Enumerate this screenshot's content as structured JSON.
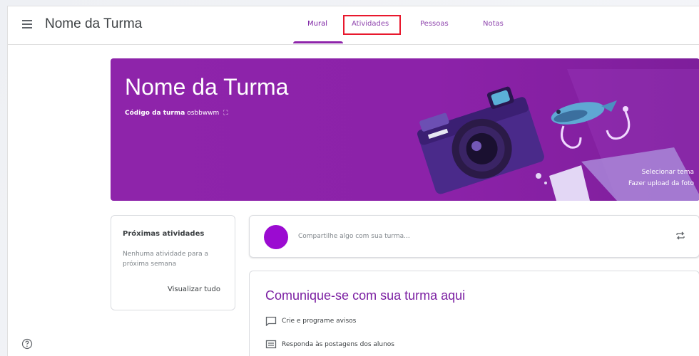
{
  "header": {
    "class_name": "Nome da Turma",
    "tabs": [
      {
        "label": "Mural",
        "active": true
      },
      {
        "label": "Atividades",
        "highlighted": true
      },
      {
        "label": "Pessoas"
      },
      {
        "label": "Notas"
      }
    ],
    "highlight_color": "#e8182d"
  },
  "banner": {
    "title": "Nome da Turma",
    "code_label": "Código da turma",
    "code_value": "osbbwwm",
    "select_theme": "Selecionar tema",
    "upload_photo": "Fazer upload da foto",
    "color": "#8e24aa"
  },
  "upcoming": {
    "title": "Próximas atividades",
    "empty_text": "Nenhuma atividade para a próxima semana",
    "view_all": "Visualizar tudo"
  },
  "share": {
    "placeholder": "Compartilhe algo com sua turma...",
    "avatar_color": "#9b0bd1"
  },
  "communicate": {
    "title": "Comunique-se com sua turma aqui",
    "items": [
      {
        "icon": "comment-icon",
        "label": "Crie e programe avisos"
      },
      {
        "icon": "chat-list-icon",
        "label": "Responda às postagens dos alunos"
      }
    ]
  },
  "icons": {
    "menu": "menu-icon",
    "help": "help-icon",
    "repost": "repost-icon",
    "expand": "fullscreen-icon"
  }
}
